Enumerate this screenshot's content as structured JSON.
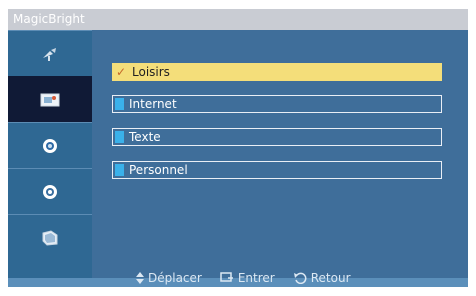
{
  "window": {
    "title": "MagicBright"
  },
  "sidebar": {
    "items": [
      {
        "icon": "satellite-icon"
      },
      {
        "icon": "picture-icon",
        "selected": true
      },
      {
        "icon": "sound-icon"
      },
      {
        "icon": "setup-icon"
      },
      {
        "icon": "input-icon"
      }
    ]
  },
  "menu": {
    "options": [
      {
        "label": "Loisirs",
        "selected": true
      },
      {
        "label": "Internet"
      },
      {
        "label": "Texte"
      },
      {
        "label": "Personnel"
      }
    ]
  },
  "footer": {
    "move_label": "Déplacer",
    "enter_label": "Entrer",
    "back_label": "Retour"
  },
  "colors": {
    "background": "#3f6e9a",
    "sidebar": "#2f6893",
    "selected_item": "#101a36",
    "highlight": "#f4de7a"
  }
}
